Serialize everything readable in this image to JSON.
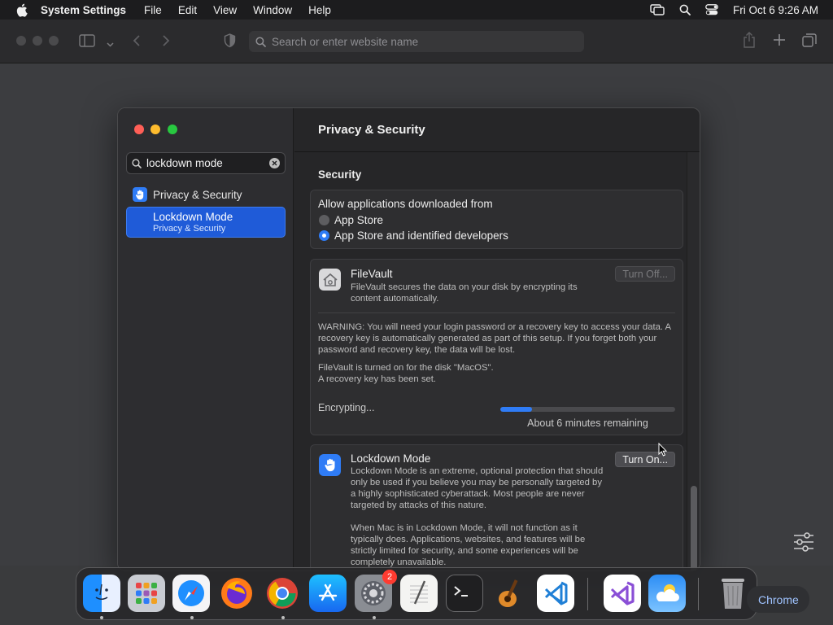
{
  "menubar": {
    "app_name": "System Settings",
    "items": [
      "File",
      "Edit",
      "View",
      "Window",
      "Help"
    ],
    "datetime": "Fri Oct 6  9:26 AM"
  },
  "browser": {
    "url_placeholder": "Search or enter website name"
  },
  "settings": {
    "search_value": "lockdown mode",
    "sidebar": [
      {
        "label": "Privacy & Security",
        "icon": "hand-icon"
      },
      {
        "label": "Lockdown Mode",
        "sublabel": "Privacy & Security",
        "selected": true
      }
    ],
    "title": "Privacy & Security",
    "section": "Security",
    "allow": {
      "title": "Allow applications downloaded from",
      "options": [
        {
          "label": "App Store",
          "selected": false
        },
        {
          "label": "App Store and identified developers",
          "selected": true
        }
      ]
    },
    "filevault": {
      "title": "FileVault",
      "desc": "FileVault secures the data on your disk by encrypting its content automatically.",
      "button": "Turn Off...",
      "warning": "WARNING: You will need your login password or a recovery key to access your data. A recovery key is automatically generated as part of this setup. If you forget both your password and recovery key, the data will be lost.",
      "status_line1": "FileVault is turned on for the disk \"MacOS\".",
      "status_line2": "A recovery key has been set.",
      "encrypting_label": "Encrypting...",
      "progress_percent": 18,
      "remaining": "About 6 minutes remaining"
    },
    "lockdown": {
      "title": "Lockdown Mode",
      "desc1": "Lockdown Mode is an extreme, optional protection that should only be used if you believe you may be personally targeted by a highly sophisticated cyberattack. Most people are never targeted by attacks of this nature.",
      "desc2": "When Mac is in Lockdown Mode, it will not function as it typically does. Applications, websites, and features will be strictly limited for security, and some experiences will be completely unavailable.",
      "button": "Turn On..."
    }
  },
  "dock": {
    "apps": [
      "Finder",
      "Launchpad",
      "Safari",
      "Firefox",
      "Chrome",
      "App Store",
      "System Settings",
      "TextEdit",
      "Terminal",
      "GarageBand",
      "Visual Studio Code",
      "Visual Studio",
      "Weather",
      "Trash"
    ],
    "settings_badge": "2",
    "chrome_pill": "Chrome"
  },
  "colors": {
    "accent": "#2f7cf6",
    "selection": "#1f5bd8"
  }
}
